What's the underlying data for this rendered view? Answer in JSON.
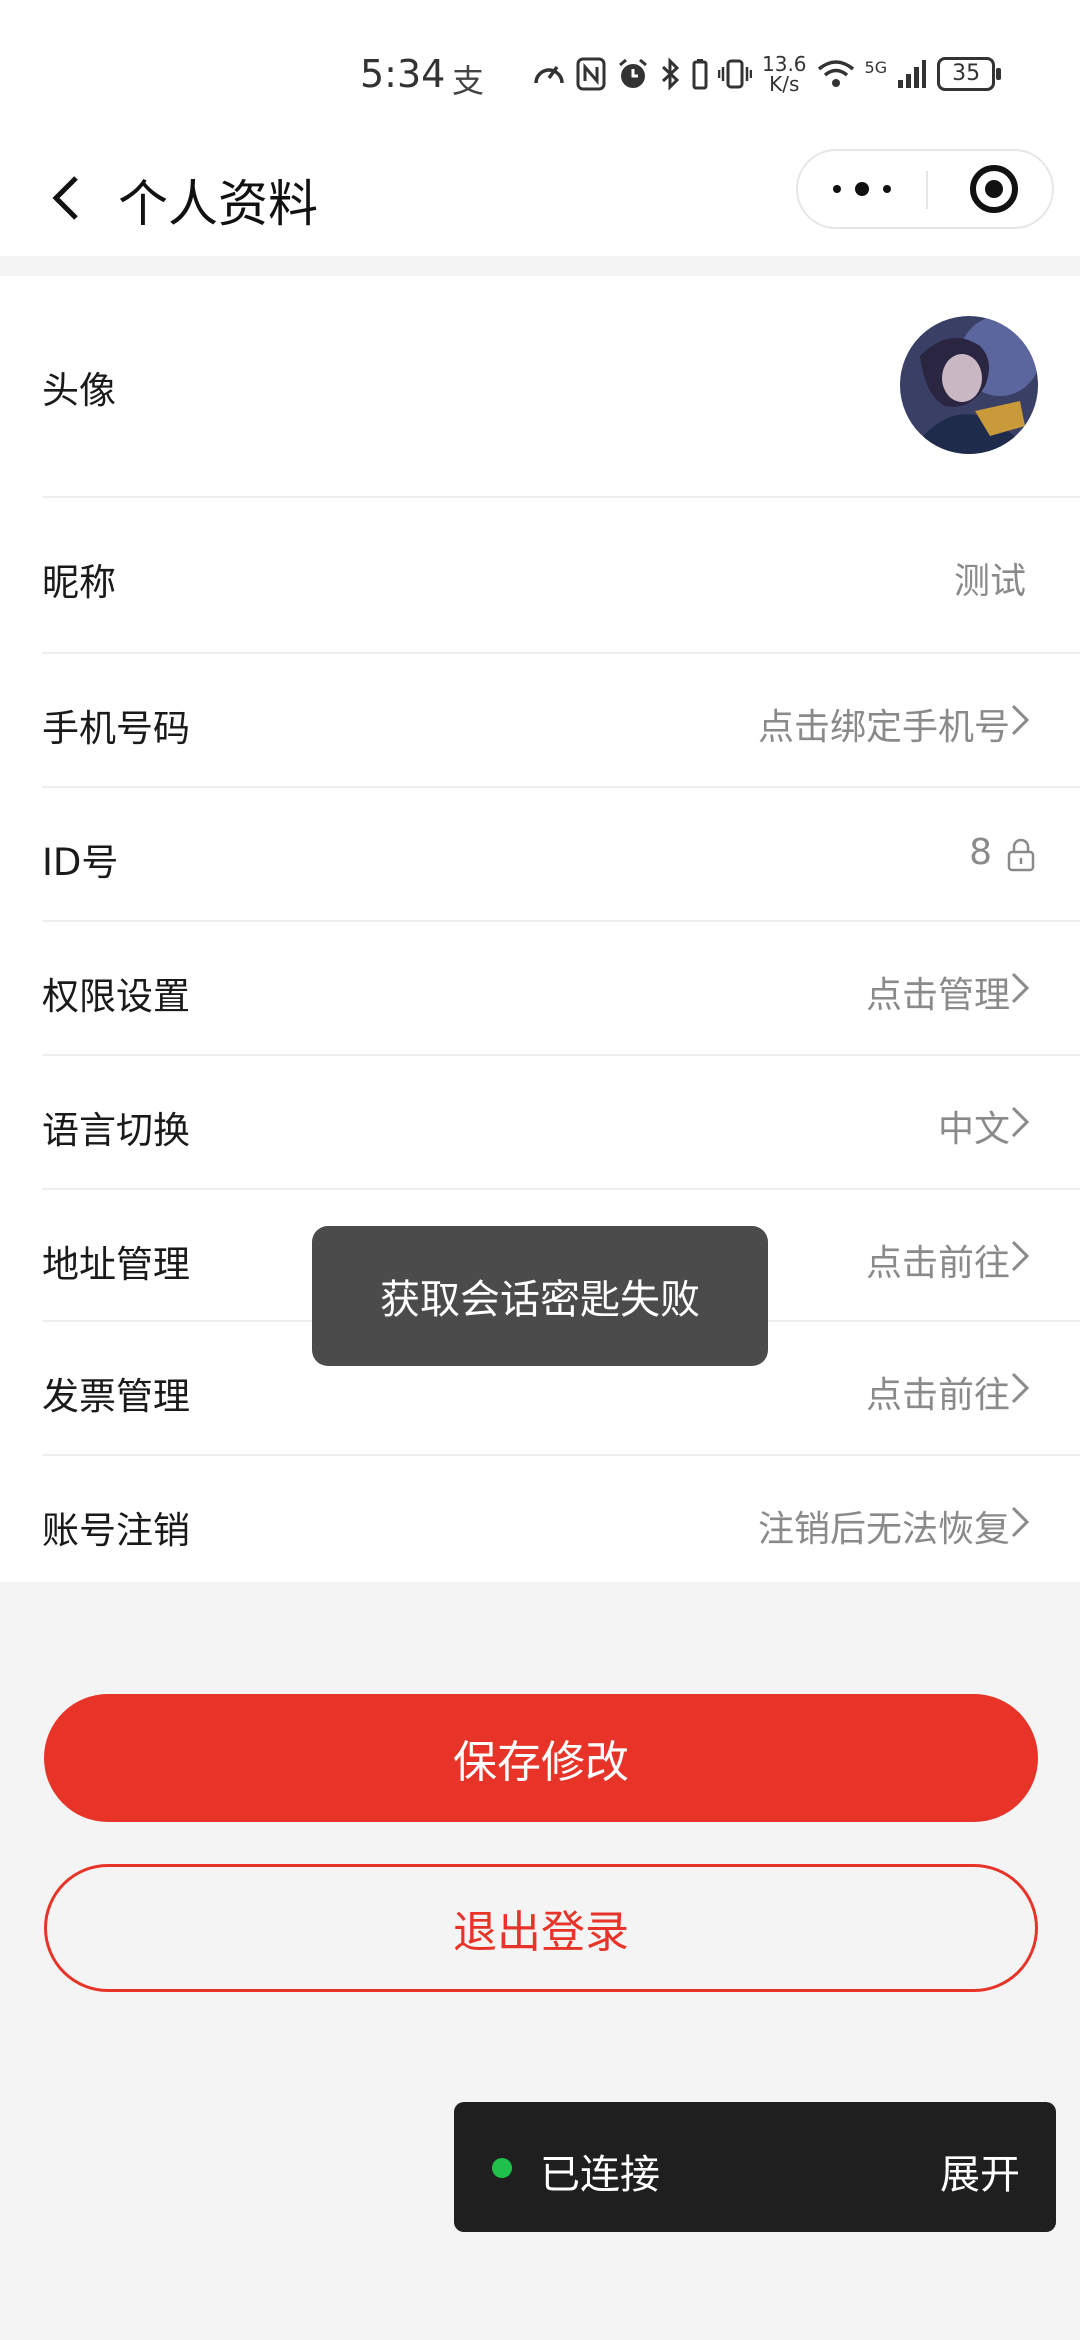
{
  "status_bar": {
    "time": "5:34",
    "alipay_glyph": "支",
    "speed_top": "13.6",
    "speed_bottom": "K/s",
    "network": "5G",
    "battery": "35",
    "icons": [
      "speedometer-icon",
      "nfc-icon",
      "alarm-icon",
      "bluetooth-icon",
      "vibrate-icon",
      "wifi-icon",
      "signal-icon"
    ]
  },
  "nav": {
    "title": "个人资料"
  },
  "profile": {
    "rows": [
      {
        "label": "头像"
      },
      {
        "label": "昵称",
        "value": "测试"
      },
      {
        "label": "手机号码",
        "value": "点击绑定手机号"
      },
      {
        "label": "ID号",
        "value": "8"
      },
      {
        "label": "权限设置",
        "value": "点击管理"
      },
      {
        "label": "语言切换",
        "value": "中文"
      },
      {
        "label": "地址管理",
        "value": "点击前往"
      },
      {
        "label": "发票管理",
        "value": "点击前往"
      },
      {
        "label": "账号注销",
        "value": "注销后无法恢复"
      }
    ]
  },
  "toast": {
    "message": "获取会话密匙失败"
  },
  "buttons": {
    "save": "保存修改",
    "logout": "退出登录"
  },
  "connection": {
    "status": "已连接",
    "expand": "展开"
  },
  "colors": {
    "accent": "#e83428",
    "online": "#21c04b",
    "toast_bg": "#4b4b4b",
    "bar_bg": "#1f1f1f"
  }
}
